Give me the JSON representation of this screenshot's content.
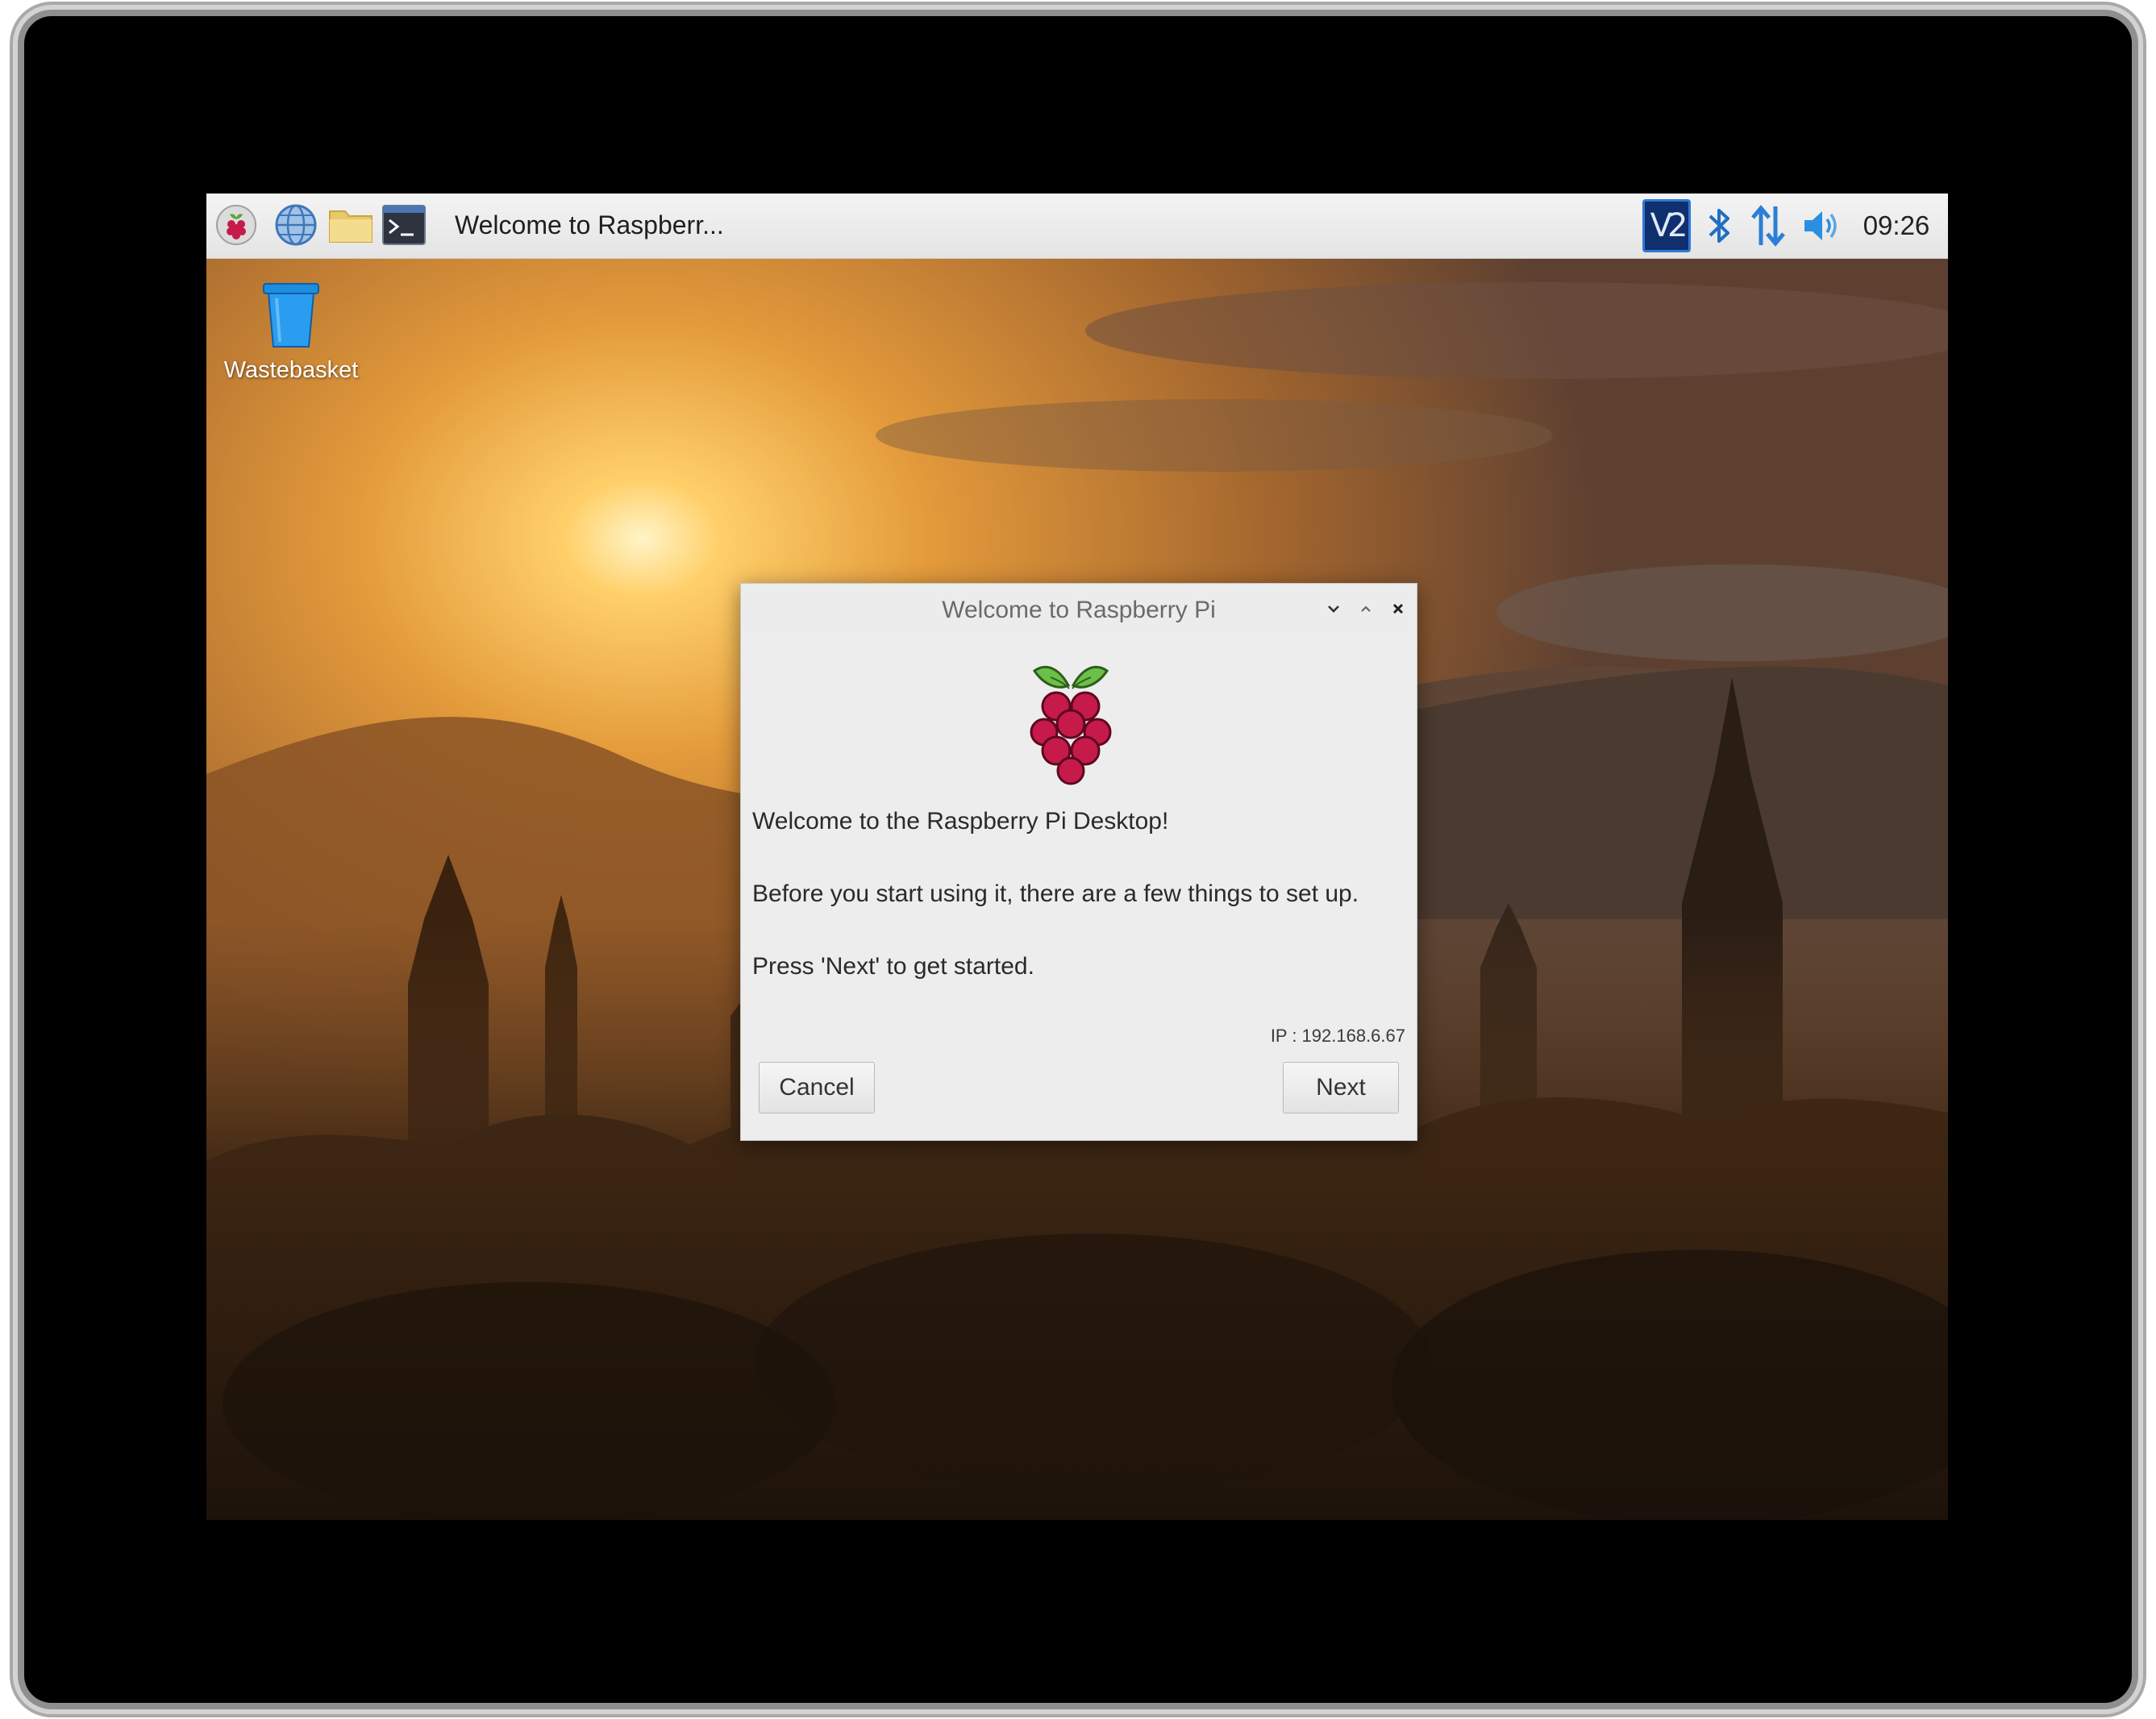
{
  "taskbar": {
    "launchers": [
      {
        "icon": "raspberry-menu-icon"
      },
      {
        "icon": "web-browser-globe-icon"
      },
      {
        "icon": "file-manager-folder-icon"
      },
      {
        "icon": "terminal-icon"
      }
    ],
    "task_label": "Welcome to Raspberr...",
    "tray": {
      "vnc_label": "V2",
      "icons": [
        "vnc-icon",
        "bluetooth-icon",
        "network-arrows-icon",
        "volume-icon"
      ],
      "clock": "09:26"
    }
  },
  "desktop": {
    "icons": [
      {
        "label": "Wastebasket",
        "icon": "wastebasket-icon"
      }
    ]
  },
  "dialog": {
    "title": "Welcome to Raspberry Pi",
    "window_controls": [
      "minimize-icon",
      "maximize-icon",
      "close-icon"
    ],
    "messages": [
      "Welcome to the Raspberry Pi Desktop!",
      "Before you start using it, there are a few things to set up.",
      "Press 'Next' to get started."
    ],
    "ip_text": "IP : 192.168.6.67",
    "cancel_label": "Cancel",
    "next_label": "Next"
  },
  "colors": {
    "bezel": "#000000",
    "taskbar_bg": "#ececec",
    "dialog_bg": "#ededed",
    "raspberry_red": "#c51a4a",
    "leaf_green": "#6cc04a",
    "accent_blue": "#2f79d6"
  }
}
